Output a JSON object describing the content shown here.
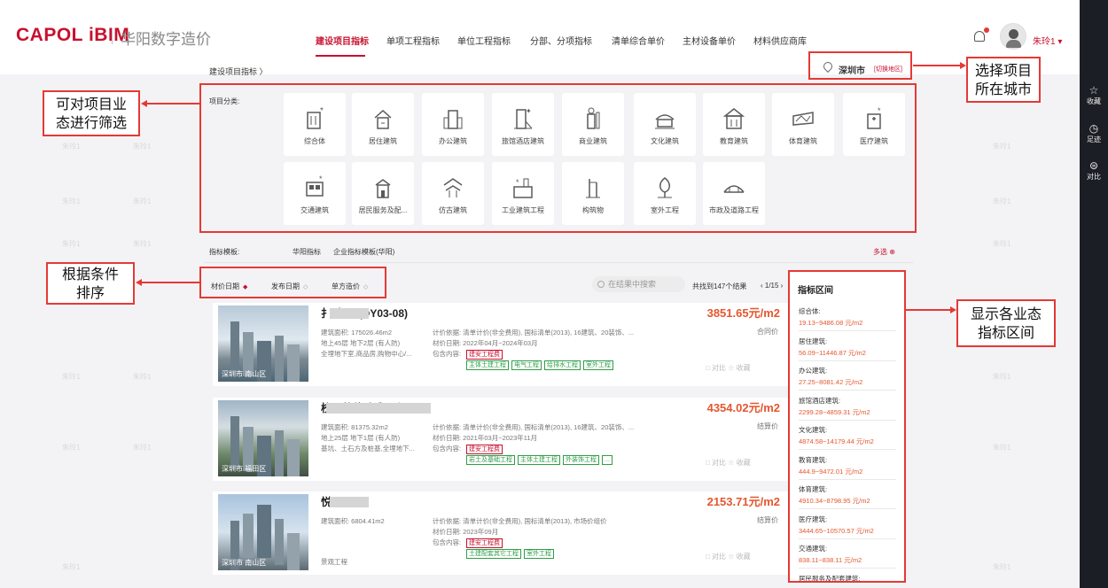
{
  "brand": {
    "logo": "CAPOL iBIM",
    "name_cn": "华阳数字造价"
  },
  "nav": {
    "items": [
      "建设项目指标",
      "单项工程指标",
      "单位工程指标",
      "分部、分项指标",
      "清单综合单价",
      "主材设备单价",
      "材料供应商库"
    ],
    "active_index": 0
  },
  "user": {
    "name": "朱玲1 ▾"
  },
  "right_sidebar": {
    "items": [
      {
        "icon": "star-icon",
        "glyph": "☆",
        "label": "收藏"
      },
      {
        "icon": "clock-icon",
        "glyph": "◷",
        "label": "足迹"
      },
      {
        "icon": "compare-icon",
        "glyph": "⊜",
        "label": "对比"
      }
    ]
  },
  "breadcrumb": "建设项目指标 〉",
  "city": {
    "name": "深圳市",
    "switch_label": "[切换地区]"
  },
  "category": {
    "label": "项目分类:",
    "items": [
      {
        "label": "综合体",
        "icon": "complex-building-icon"
      },
      {
        "label": "居住建筑",
        "icon": "residential-icon"
      },
      {
        "label": "办公建筑",
        "icon": "office-icon"
      },
      {
        "label": "旅馆酒店建筑",
        "icon": "hotel-icon"
      },
      {
        "label": "商业建筑",
        "icon": "commercial-icon"
      },
      {
        "label": "文化建筑",
        "icon": "culture-icon"
      },
      {
        "label": "教育建筑",
        "icon": "education-icon"
      },
      {
        "label": "体育建筑",
        "icon": "sports-icon"
      },
      {
        "label": "医疗建筑",
        "icon": "medical-icon"
      },
      {
        "label": "交通建筑",
        "icon": "transport-icon"
      },
      {
        "label": "居民服务及配...",
        "icon": "resident-service-icon"
      },
      {
        "label": "仿古建筑",
        "icon": "antique-building-icon"
      },
      {
        "label": "工业建筑工程",
        "icon": "industrial-icon"
      },
      {
        "label": "构筑物",
        "icon": "structure-icon"
      },
      {
        "label": "室外工程",
        "icon": "outdoor-icon"
      },
      {
        "label": "市政及道路工程",
        "icon": "municipal-road-icon"
      }
    ]
  },
  "template": {
    "label": "指标模板:",
    "options": [
      "华阳指标",
      "企业指标模板(华阳)"
    ],
    "multi": "多选 ⊕"
  },
  "sort": {
    "items": [
      "材价日期",
      "发布日期",
      "单方造价"
    ]
  },
  "search": {
    "placeholder": "在结果中搜索"
  },
  "results": {
    "found": "共找到147个结果",
    "pager": "‹ 1/15 ›"
  },
  "projects": [
    {
      "name": "扌 家园 (DY03-08)",
      "location": "深圳市 南山区",
      "area": "建筑面积: 175026.46m2",
      "floors": "地上45层 地下2层 (有人防)",
      "desc": "全埋地下室,商品房,购物中心/...",
      "basis": "计价依据: 清单计价(非全费用), 国标清单(2013), 16建筑、20装饰、...",
      "date": "材价日期: 2022年04月~2024年03月",
      "content_label": "包含内容:",
      "red_tag": "建安工程费",
      "tags": [
        "主体土建工程",
        "电气工程",
        "给排水工程",
        "室外工程"
      ],
      "price": "3851.65元/m2",
      "ptype": "合同价",
      "compare": "□ 对比  ☆ 收藏"
    },
    {
      "name": "校区整体改造工程",
      "location": "深圳市 福田区",
      "area": "建筑面积: 81375.32m2",
      "floors": "地上25层 地下1层 (有人防)",
      "desc": "基坑、土石方及桩基,全埋地下...",
      "basis": "计价依据: 清单计价(非全费用), 国标清单(2013), 16建筑、20装饰、...",
      "date": "材价日期: 2021年03月~2023年11月",
      "content_label": "包含内容:",
      "red_tag": "建安工程费",
      "tags": [
        "岩土及基础工程",
        "主体土建工程",
        "外装饰工程",
        "..."
      ],
      "price": "4354.02元/m2",
      "ptype": "结算价",
      "compare": "□ 对比  ☆ 收藏"
    },
    {
      "name": "悦项目",
      "location": "深圳市 南山区",
      "area": "建筑面积: 6804.41m2",
      "floors": "",
      "desc": "景观工程",
      "basis": "计价依据: 清单计价(非全费用), 国标清单(2013), 市场价组价",
      "date": "材价日期: 2023年09月",
      "content_label": "包含内容:",
      "red_tag": "建安工程费",
      "tags": [
        "土建配套其它工程",
        "室外工程"
      ],
      "price": "2153.71元/m2",
      "ptype": "结算价",
      "compare": "□ 对比  ☆ 收藏"
    }
  ],
  "range": {
    "title": "指标区间",
    "items": [
      {
        "k": "综合体:",
        "v": "19.13~9486.08 元/m2"
      },
      {
        "k": "居住建筑:",
        "v": "56.09~11446.87 元/m2"
      },
      {
        "k": "办公建筑:",
        "v": "27.25~8081.42 元/m2"
      },
      {
        "k": "旅馆酒店建筑:",
        "v": "2299.28~4859.31 元/m2"
      },
      {
        "k": "文化建筑:",
        "v": "4874.58~14179.44 元/m2"
      },
      {
        "k": "教育建筑:",
        "v": "444.9~9472.01 元/m2"
      },
      {
        "k": "体育建筑:",
        "v": "4910.34~8798.95 元/m2"
      },
      {
        "k": "医疗建筑:",
        "v": "3444.65~10570.57 元/m2"
      },
      {
        "k": "交通建筑:",
        "v": "838.11~838.11 元/m2"
      },
      {
        "k": "居民服务及配套建筑:",
        "v": ""
      }
    ]
  },
  "annotations": {
    "city": "选择项目\n所在城市",
    "filter": "可对项目业\n态进行筛选",
    "sort": "根据条件\n排序",
    "range": "显示各业态\n指标区间"
  },
  "watermark": "朱玲1"
}
